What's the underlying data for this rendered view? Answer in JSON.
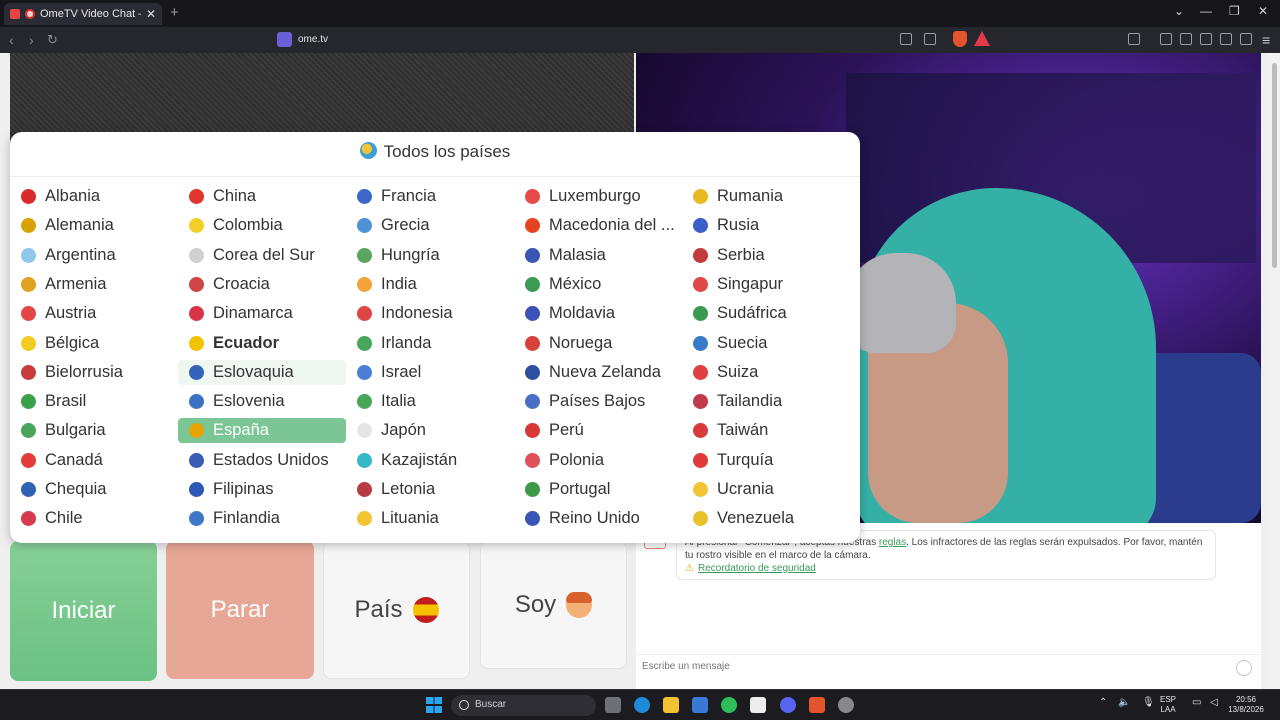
{
  "browser": {
    "tab_title": "OmeTV Video Chat — Omeg",
    "url": "ome.tv",
    "new_tab_symbol": "+",
    "close_symbol": "✕"
  },
  "panel": {
    "title": "Todos los países",
    "countries": [
      [
        "Albania",
        "Alemania",
        "Argentina",
        "Armenia",
        "Austria",
        "Bélgica",
        "Bielorrusia",
        "Brasil",
        "Bulgaria",
        "Canadá",
        "Chequia",
        "Chile"
      ],
      [
        "China",
        "Colombia",
        "Corea del Sur",
        "Croacia",
        "Dinamarca",
        "Ecuador",
        "Eslovaquia",
        "Eslovenia",
        "España",
        "Estados Unidos",
        "Filipinas",
        "Finlandia"
      ],
      [
        "Francia",
        "Grecia",
        "Hungría",
        "India",
        "Indonesia",
        "Irlanda",
        "Israel",
        "Italia",
        "Japón",
        "Kazajistán",
        "Letonia",
        "Lituania"
      ],
      [
        "Luxemburgo",
        "Macedonia del ...",
        "Malasia",
        "México",
        "Moldavia",
        "Noruega",
        "Nueva Zelanda",
        "Países Bajos",
        "Perú",
        "Polonia",
        "Portugal",
        "Reino Unido"
      ],
      [
        "Rumania",
        "Rusia",
        "Serbia",
        "Singapur",
        "Sudáfrica",
        "Suecia",
        "Suiza",
        "Tailandia",
        "Taiwán",
        "Turquía",
        "Ucrania",
        "Venezuela"
      ]
    ],
    "flag_colors": [
      [
        "#d92b2b",
        "#d8a300",
        "#8fc7ea",
        "#e0a020",
        "#e24646",
        "#f2cc23",
        "#c83b3b",
        "#3aa14a",
        "#4aa55a",
        "#e53b3b",
        "#2f63b5",
        "#d73b4f"
      ],
      [
        "#e0362c",
        "#f3cf2a",
        "#d0d0d0",
        "#d04545",
        "#d8344a",
        "#f2c400",
        "#3463b7",
        "#3b73c2",
        "#e6a400",
        "#3c5bb4",
        "#2e58b5",
        "#3f78c9"
      ],
      [
        "#3c68c9",
        "#4f93d6",
        "#5ba65e",
        "#f2a43a",
        "#e04545",
        "#47a65c",
        "#4b7ed6",
        "#4aa659",
        "#e5e5e5",
        "#35b8c8",
        "#b83a45",
        "#f3c534"
      ],
      [
        "#e84a4a",
        "#e64321",
        "#3b55b4",
        "#3b9a54",
        "#3d52b8",
        "#d8413a",
        "#2f4fa0",
        "#4a6ec4",
        "#d93838",
        "#e04f5a",
        "#3b9a4a",
        "#3856b3"
      ],
      [
        "#e8b920",
        "#3d5fcc",
        "#c33b3b",
        "#e04747",
        "#3a9a52",
        "#3979c9",
        "#e04040",
        "#c13a4e",
        "#d73b3b",
        "#e03a3a",
        "#f2c534",
        "#e8c22a"
      ]
    ],
    "hover_cell": "Eslovaquia",
    "selected_cell": "España",
    "bold_cell": "Ecuador"
  },
  "buttons": {
    "start": "Iniciar",
    "stop": "Parar",
    "country": "País",
    "me": "Soy"
  },
  "chat": {
    "logo_text": "TV",
    "notice_pre": "Al presionar \"Comenzar\", aceptas nuestras",
    "notice_rules": "reglas",
    "notice_post": ". Los infractores de las reglas serán expulsados. Por favor, mantén tu rostro visible en el marco de la cámara.",
    "reminder": "Recordatorio de seguridad",
    "placeholder": "Escribe un mensaje"
  },
  "taskbar": {
    "search": "Buscar",
    "lang1": "ESP",
    "lang2": "LAA",
    "time": "20:56",
    "date": "13/8/2026"
  }
}
